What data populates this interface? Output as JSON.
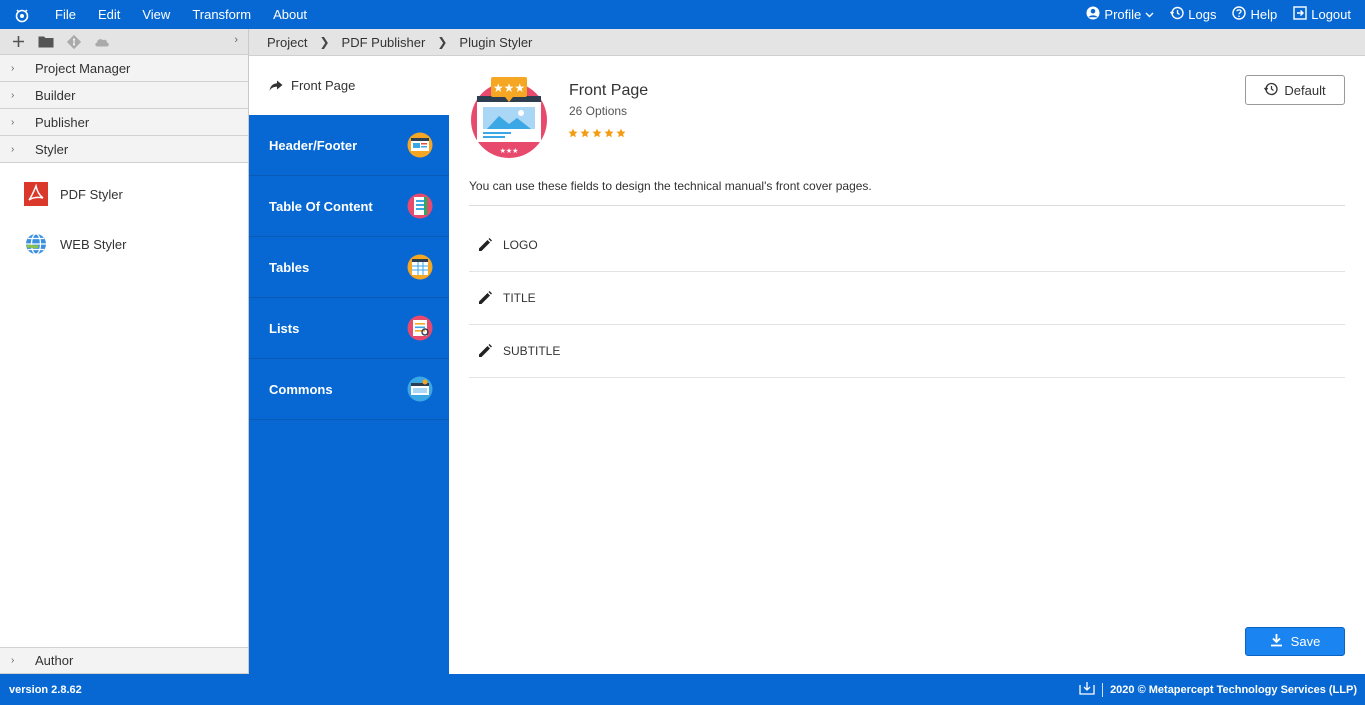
{
  "menubar": {
    "menus": [
      "File",
      "Edit",
      "View",
      "Transform",
      "About"
    ],
    "profile_label": "Profile",
    "logs_label": "Logs",
    "help_label": "Help",
    "logout_label": "Logout"
  },
  "sidebar": {
    "sections": [
      "Project Manager",
      "Builder",
      "Publisher",
      "Styler"
    ],
    "stylers": [
      {
        "label": "PDF Styler",
        "icon": "pdf-icon"
      },
      {
        "label": "WEB Styler",
        "icon": "globe-icon"
      }
    ],
    "author_label": "Author"
  },
  "breadcrumb": [
    "Project",
    "PDF Publisher",
    "Plugin Styler"
  ],
  "categories": {
    "active": "Front Page",
    "items": [
      {
        "label": "Header/Footer",
        "icon": "header-footer-icon"
      },
      {
        "label": "Table Of Content",
        "icon": "toc-icon"
      },
      {
        "label": "Tables",
        "icon": "tables-icon"
      },
      {
        "label": "Lists",
        "icon": "lists-icon"
      },
      {
        "label": "Commons",
        "icon": "commons-icon"
      }
    ]
  },
  "main": {
    "title": "Front Page",
    "options": "26 Options",
    "rating": 5,
    "default_label": "Default",
    "description": "You can use these fields to design the technical manual's front cover pages.",
    "fields": [
      "LOGO",
      "TITLE",
      "SUBTITLE"
    ],
    "save_label": "Save"
  },
  "footer": {
    "version": "version 2.8.62",
    "copyright": "2020 © Metapercept Technology Services (LLP)"
  },
  "colors": {
    "brand_blue": "#0768d3",
    "save_blue": "#1a84f0",
    "star_orange": "#f39c12",
    "pdf_red": "#d9382b"
  }
}
